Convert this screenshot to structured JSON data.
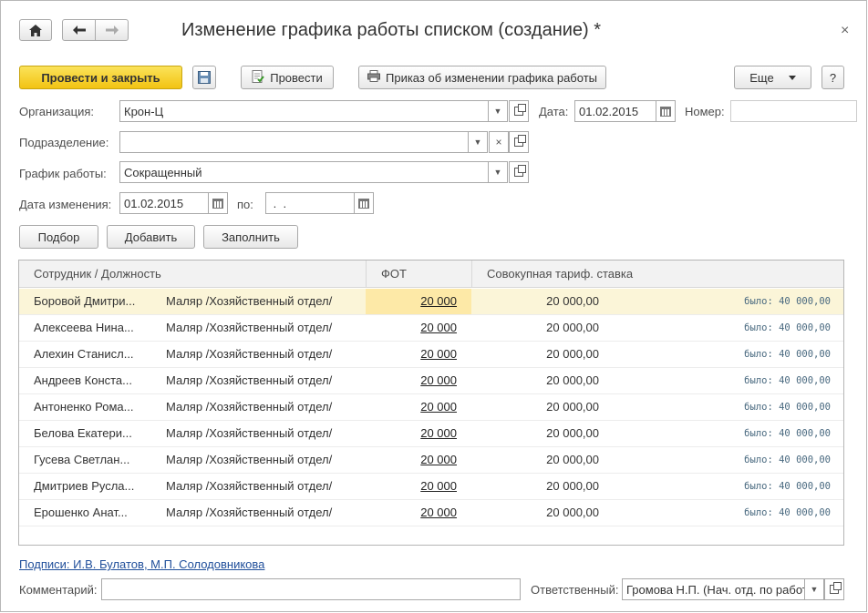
{
  "window": {
    "title": "Изменение графика работы списком (создание) *",
    "close_glyph": "×"
  },
  "toolbar": {
    "post_close": "Провести и закрыть",
    "post": "Провести",
    "order": "Приказ об изменении графика работы",
    "more": "Еще",
    "help": "?"
  },
  "form": {
    "org_label": "Организация:",
    "org_value": "Крон-Ц",
    "date_label": "Дата:",
    "date_value": "01.02.2015",
    "number_label": "Номер:",
    "number_value": "",
    "dept_label": "Подразделение:",
    "dept_value": "",
    "schedule_label": "График работы:",
    "schedule_value": "Сокращенный",
    "change_date_label": "Дата изменения:",
    "change_date_value": "01.02.2015",
    "to_label": "по:",
    "to_value": " .  . "
  },
  "actions": {
    "pick": "Подбор",
    "add": "Добавить",
    "fill": "Заполнить"
  },
  "table": {
    "headers": {
      "employee": "Сотрудник / Должность",
      "fot": "ФОТ",
      "tarif": "Совокупная тариф. ставка"
    },
    "rows": [
      {
        "name": "Боровой Дмитри...",
        "position": "Маляр /Хозяйственный отдел/",
        "fot": "20 000",
        "tarif": "20 000,00",
        "was": "было:  40 000,00"
      },
      {
        "name": "Алексеева Нина...",
        "position": "Маляр /Хозяйственный отдел/",
        "fot": "20 000",
        "tarif": "20 000,00",
        "was": "было:  40 000,00"
      },
      {
        "name": "Алехин Станисл...",
        "position": "Маляр /Хозяйственный отдел/",
        "fot": "20 000",
        "tarif": "20 000,00",
        "was": "было:  40 000,00"
      },
      {
        "name": "Андреев Конста...",
        "position": "Маляр /Хозяйственный отдел/",
        "fot": "20 000",
        "tarif": "20 000,00",
        "was": "было:  40 000,00"
      },
      {
        "name": "Антоненко Рома...",
        "position": "Маляр /Хозяйственный отдел/",
        "fot": "20 000",
        "tarif": "20 000,00",
        "was": "было:  40 000,00"
      },
      {
        "name": "Белова Екатери...",
        "position": "Маляр /Хозяйственный отдел/",
        "fot": "20 000",
        "tarif": "20 000,00",
        "was": "было:  40 000,00"
      },
      {
        "name": "Гусева Светлан...",
        "position": "Маляр /Хозяйственный отдел/",
        "fot": "20 000",
        "tarif": "20 000,00",
        "was": "было:  40 000,00"
      },
      {
        "name": "Дмитриев Русла...",
        "position": "Маляр /Хозяйственный отдел/",
        "fot": "20 000",
        "tarif": "20 000,00",
        "was": "было:  40 000,00"
      },
      {
        "name": "Ерошенко Анат...",
        "position": "Маляр /Хозяйственный отдел/",
        "fot": "20 000",
        "tarif": "20 000,00",
        "was": "было:  40 000,00"
      }
    ]
  },
  "footer": {
    "signatures": "Подписи: И.В. Булатов, М.П. Солодовникова",
    "comment_label": "Комментарий:",
    "comment_value": "",
    "responsible_label": "Ответственный:",
    "responsible_value": "Громова Н.П. (Нач. отд. по работ"
  }
}
